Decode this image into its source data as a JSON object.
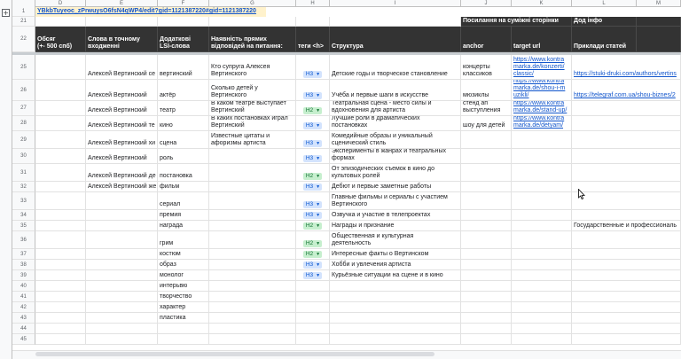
{
  "columns": [
    "D",
    "E",
    "F",
    "G",
    "H",
    "I",
    "J",
    "K",
    "L",
    "M"
  ],
  "url_cell": "YBkbTuyeoc_zPrwuysO6fsN4qWP4/edit?gid=1121387220#gid=1121387220",
  "header_row_21": {
    "rownum": "21",
    "J": "Посилання на суміжні сторінки",
    "L": "Дод інфо"
  },
  "header_row_22": {
    "rownum": "22",
    "D": "Обсяг\n(+- 500 спб)",
    "E": "Слова в точному\nвходженні",
    "F": "Додаткові\nLSI-слова",
    "G": "Наявність прямих\nвідповідей на питання:",
    "H": "теги <h>",
    "I": "Структура",
    "J": "anchor",
    "K": "target url",
    "L": "Приклади статей"
  },
  "rows": [
    {
      "n": "25",
      "E": "Алексей Вертинский се",
      "F": "вертинский",
      "G": "Кто супруга Алексея\nВертинского",
      "H": "H3",
      "I": "Детские годы и творческое становление",
      "J": "концерты\nклассиков",
      "K": "https://www.kontra\nmarka.de/konzerti/\nclassic/",
      "L": "https://stuki-druki.com/authors/vertins"
    },
    {
      "n": "26",
      "E": "Алексей Вертинский",
      "F": "актёр",
      "G": "Сколько детей у\nВертинского",
      "H": "H3",
      "I": "Учёба и первые шаги в искусстве",
      "J": "мюзиклы",
      "K": "https://www.kontra\nmarka.de/shou-i-m\nuzikli/",
      "L": "https://telegraf.com.ua/shou-biznes/2"
    },
    {
      "n": "27",
      "E": "Алексей Вертинский",
      "F": "театр",
      "G": "В каком театре выступает\nВертинский",
      "H": "H2",
      "I": "Театральная сцена - место силы и\nвдохновения для артиста",
      "J": "стенд ап\nвыступления",
      "K": "https://www.kontra\nmarka.de/stand-up/",
      "L": ""
    },
    {
      "n": "28",
      "E": "Алексей Вертинский те",
      "F": "кино",
      "G": "В каких постановках играл\nВертинский",
      "H": "H3",
      "I": "Лучшие роли в драматических\nпостановках",
      "J": "шоу для детей",
      "K": "https://www.kontra\nmarka.de/detyam/",
      "L": ""
    },
    {
      "n": "29",
      "E": "Алексей Вертинский хи",
      "F": "сцена",
      "G": "Известные цитаты и\nафоризмы артиста",
      "H": "H3",
      "I": "Комедийные образы и уникальный\nсценический стиль",
      "J": "",
      "K": "",
      "L": ""
    },
    {
      "n": "30",
      "E": "Алексей Вертинский",
      "F": "роль",
      "G": "",
      "H": "H3",
      "I": "Эксперименты в жанрах и театральных\nформах",
      "J": "",
      "K": "",
      "L": ""
    },
    {
      "n": "31",
      "E": "Алексей Вертинский де",
      "F": "постановка",
      "G": "",
      "H": "H2",
      "I": "От эпизодических съемок в кино до\nкультовых ролей",
      "J": "",
      "K": "",
      "L": ""
    },
    {
      "n": "32",
      "E": "Алексей Вертинский же",
      "F": "фильм",
      "G": "",
      "H": "H3",
      "I": "Дебют и первые заметные работы",
      "J": "",
      "K": "",
      "L": ""
    },
    {
      "n": "33",
      "E": "",
      "F": "сериал",
      "G": "",
      "H": "H3",
      "I": "Главные фильмы и сериалы с участием\nВертинского",
      "J": "",
      "K": "",
      "L": ""
    },
    {
      "n": "34",
      "E": "",
      "F": "премия",
      "G": "",
      "H": "H3",
      "I": "Озвучка и участие в телепроектах",
      "J": "",
      "K": "",
      "L": ""
    },
    {
      "n": "35",
      "E": "",
      "F": "награда",
      "G": "",
      "H": "H2",
      "I": "Награды и признание",
      "J": "",
      "K": "",
      "L": "Государственные и профессиональ"
    },
    {
      "n": "36",
      "E": "",
      "F": "грим",
      "G": "",
      "H": "H2",
      "I": "Общественная и культурная\nдеятельность",
      "J": "",
      "K": "",
      "L": ""
    },
    {
      "n": "37",
      "E": "",
      "F": "костюм",
      "G": "",
      "H": "H2",
      "I": "Интересные факты о Вертинском",
      "J": "",
      "K": "",
      "L": ""
    },
    {
      "n": "38",
      "E": "",
      "F": "образ",
      "G": "",
      "H": "H3",
      "I": "Хобби и увлечения артиста",
      "J": "",
      "K": "",
      "L": ""
    },
    {
      "n": "39",
      "E": "",
      "F": "монолог",
      "G": "",
      "H": "H3",
      "I": "Курьёзные ситуации на сцене и в кино",
      "J": "",
      "K": "",
      "L": ""
    },
    {
      "n": "40",
      "E": "",
      "F": "интерьвю",
      "G": "",
      "H": "",
      "I": "",
      "J": "",
      "K": "",
      "L": ""
    },
    {
      "n": "41",
      "E": "",
      "F": "творчество",
      "G": "",
      "H": "",
      "I": "",
      "J": "",
      "K": "",
      "L": ""
    },
    {
      "n": "42",
      "E": "",
      "F": "характер",
      "G": "",
      "H": "",
      "I": "",
      "J": "",
      "K": "",
      "L": ""
    },
    {
      "n": "43",
      "E": "",
      "F": "пластика",
      "G": "",
      "H": "",
      "I": "",
      "J": "",
      "K": "",
      "L": ""
    },
    {
      "n": "44",
      "E": "",
      "F": "",
      "G": "",
      "H": "",
      "I": "",
      "J": "",
      "K": "",
      "L": ""
    },
    {
      "n": "45",
      "E": "",
      "F": "",
      "G": "",
      "H": "",
      "I": "",
      "J": "",
      "K": "",
      "L": ""
    }
  ],
  "row_1_num": "1",
  "dropdown_glyph": "▼",
  "colors": {
    "h3_bg": "#d3e3fd",
    "h2_bg": "#c6efce",
    "dark_header": "#333333",
    "link": "#1155cc"
  },
  "icons": {
    "expand": "plus-icon",
    "dropdown": "chevron-down-icon",
    "cursor": "mouse-pointer-icon"
  }
}
